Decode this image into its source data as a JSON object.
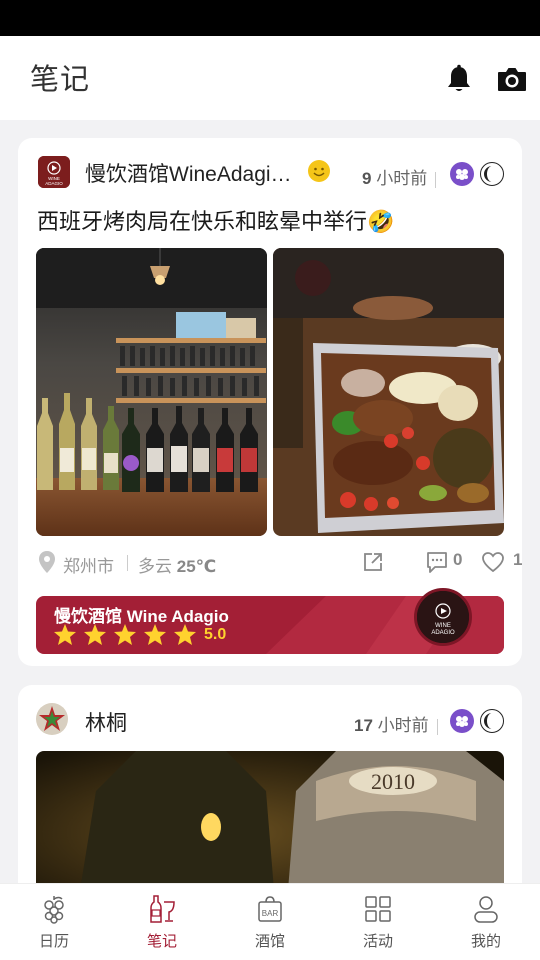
{
  "header": {
    "title": "笔记"
  },
  "posts": [
    {
      "author": "慢饮酒馆WineAdagi…",
      "time_number": "9",
      "time_unit": "小时前",
      "text": "西班牙烤肉局在快乐和眩晕中举行🤣",
      "location": "郑州市",
      "weather": "多云",
      "temperature": "25℃",
      "comments": "0",
      "likes": "1",
      "bar": {
        "name": "慢饮酒馆 Wine Adagio",
        "rating": "5.0",
        "stars": 5,
        "logo_text_1": "WINE",
        "logo_text_2": "ADAGIO"
      }
    },
    {
      "author": "林桐",
      "time_number": "17",
      "time_unit": "小时前",
      "photo_label": "2010"
    }
  ],
  "avatar_logo": {
    "line1": "WINE",
    "line2": "ADAGIO"
  },
  "nav": [
    {
      "label": "日历",
      "icon": "grape-icon",
      "active": false
    },
    {
      "label": "笔记",
      "icon": "wine-bottle-glass-icon",
      "active": true
    },
    {
      "label": "酒馆",
      "icon": "bar-bag-icon",
      "active": false,
      "icon_text": "BAR"
    },
    {
      "label": "活动",
      "icon": "grid-icon",
      "active": false
    },
    {
      "label": "我的",
      "icon": "user-icon",
      "active": false
    }
  ],
  "colors": {
    "accent": "#a31f36",
    "badge_purple": "#7a4fc9",
    "star": "#ffd22e"
  }
}
